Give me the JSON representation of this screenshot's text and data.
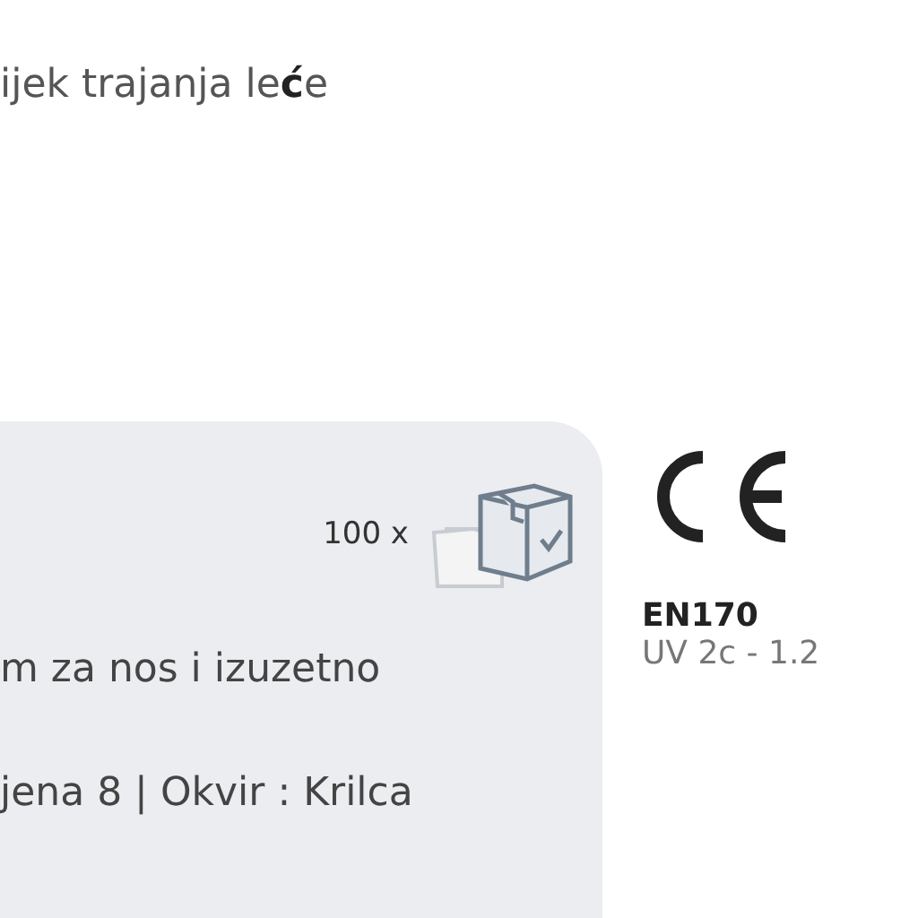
{
  "heading": "ijek trajanja le**ć**e",
  "card": {
    "quantity": "100 x",
    "lines": [
      "m za nos i izuzetno",
      "jena 8 | Okvir : Krilca"
    ]
  },
  "certification": {
    "standard": "EN170",
    "rating": "UV 2c - 1.2"
  }
}
